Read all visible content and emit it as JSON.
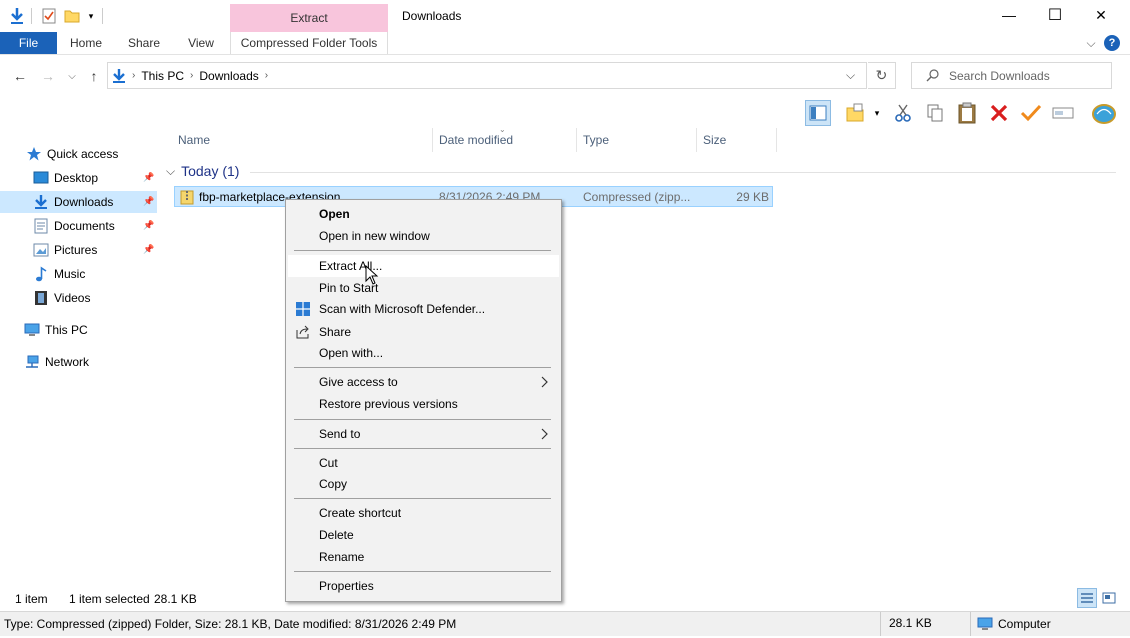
{
  "window": {
    "title": "Downloads",
    "contextual_band": "Extract",
    "minimize_glyph": "—",
    "maximize_glyph": "☐",
    "close_glyph": "✕"
  },
  "ribbon": {
    "tabs": [
      {
        "label": "File"
      },
      {
        "label": "Home"
      },
      {
        "label": "Share"
      },
      {
        "label": "View"
      },
      {
        "label": "Compressed Folder Tools"
      }
    ],
    "help_glyph": "?",
    "expand_glyph": "⌵"
  },
  "nav": {
    "back_glyph": "←",
    "forward_glyph": "→",
    "recent_glyph": "⌵",
    "up_glyph": "↑",
    "address_dropdown_glyph": "⌵",
    "refresh_glyph": "↻"
  },
  "address": {
    "breadcrumbs": [
      "This PC",
      "Downloads"
    ],
    "separator": "›"
  },
  "search": {
    "placeholder": "Search Downloads"
  },
  "navpane": {
    "items": [
      {
        "label": "Quick access",
        "icon": "star-icon",
        "pinned": false
      },
      {
        "label": "Desktop",
        "icon": "desktop-icon",
        "pinned": true
      },
      {
        "label": "Downloads",
        "icon": "download-icon",
        "pinned": true,
        "selected": true
      },
      {
        "label": "Documents",
        "icon": "documents-icon",
        "pinned": true
      },
      {
        "label": "Pictures",
        "icon": "pictures-icon",
        "pinned": true
      },
      {
        "label": "Music",
        "icon": "music-icon",
        "pinned": false
      },
      {
        "label": "Videos",
        "icon": "videos-icon",
        "pinned": false
      },
      {
        "label": "This PC",
        "icon": "computer-icon",
        "pinned": false
      },
      {
        "label": "Network",
        "icon": "network-icon",
        "pinned": false
      }
    ],
    "pin_glyph": "📌"
  },
  "filelist": {
    "columns": [
      {
        "label": "Name"
      },
      {
        "label": "Date modified"
      },
      {
        "label": "Type"
      },
      {
        "label": "Size"
      }
    ],
    "group": "Today (1)",
    "files": [
      {
        "name": "fbp-marketplace-extension",
        "date": "8/31/2026 2:49 PM",
        "type": "Compressed (zipp...",
        "size": "29 KB"
      }
    ]
  },
  "context_menu": {
    "items": [
      {
        "label": "Open",
        "bold": true
      },
      {
        "label": "Open in new window"
      },
      {
        "label": "Extract All...",
        "highlighted": true
      },
      {
        "label": "Pin to Start"
      },
      {
        "label": "Scan with Microsoft Defender...",
        "icon": "defender-icon"
      },
      {
        "label": "Share",
        "icon": "share-icon"
      },
      {
        "label": "Open with..."
      },
      {
        "label": "Give access to",
        "submenu": true
      },
      {
        "label": "Restore previous versions"
      },
      {
        "label": "Send to",
        "submenu": true
      },
      {
        "label": "Cut"
      },
      {
        "label": "Copy"
      },
      {
        "label": "Create shortcut"
      },
      {
        "label": "Delete"
      },
      {
        "label": "Rename"
      },
      {
        "label": "Properties"
      }
    ],
    "submenu_glyph": "›"
  },
  "status": {
    "item_count": "1 item",
    "selected": "1 item selected",
    "selected_size": "28.1 KB"
  },
  "details_bar": {
    "info": "Type: Compressed (zipped) Folder, Size: 28.1 KB, Date modified: 8/31/2026 2:49 PM",
    "size": "28.1 KB",
    "location": "Computer"
  },
  "colors": {
    "accent": "#1b62b8",
    "selection": "#cce8ff",
    "contextual_tab": "#f8c5dc",
    "group_header": "#1e3287"
  }
}
